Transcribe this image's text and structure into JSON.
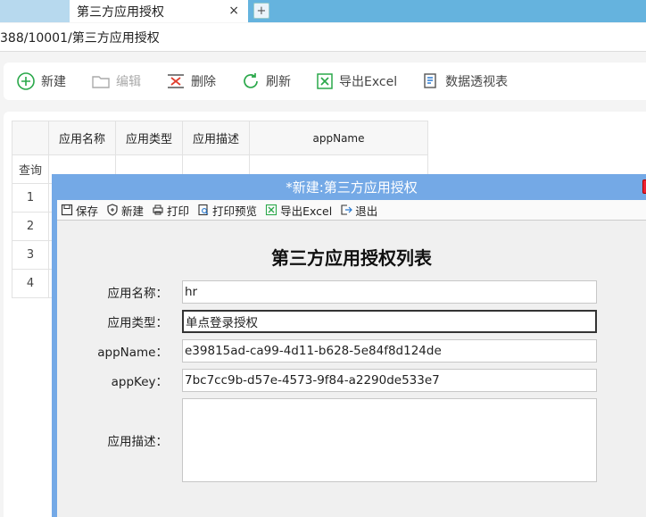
{
  "tabs": {
    "active_label": "第三方应用授权",
    "close_glyph": "×",
    "add_glyph": "+"
  },
  "breadcrumb": {
    "path": "388/10001/第三方应用授权"
  },
  "toolbar": {
    "new": "新建",
    "edit": "编辑",
    "delete": "删除",
    "refresh": "刷新",
    "export": "导出Excel",
    "pivot": "数据透视表"
  },
  "grid": {
    "columns": [
      "应用名称",
      "应用类型",
      "应用描述",
      "appName"
    ],
    "query_label": "查询",
    "row_numbers": [
      "1",
      "2",
      "3",
      "4"
    ]
  },
  "modal": {
    "title": "*新建:第三方应用授权",
    "toolbar": {
      "save": "保存",
      "new": "新建",
      "print": "打印",
      "print_preview": "打印预览",
      "export": "导出Excel",
      "exit": "退出"
    },
    "form_title": "第三方应用授权列表",
    "fields": {
      "app_name_label": "应用名称：",
      "app_name_value": "hr",
      "app_type_label": "应用类型：",
      "app_type_value": "单点登录授权",
      "appname_label": "appName：",
      "appname_value": "e39815ad-ca99-4d11-b628-5e84f8d124de",
      "appkey_label": "appKey：",
      "appkey_value": "7bc7cc9b-d57e-4573-9f84-a2290de533e7",
      "desc_label": "应用描述：",
      "desc_value": ""
    }
  },
  "colors": {
    "tabbar": "#65b3de",
    "modal_header": "#74a9e6",
    "toolbar_icon_accent": "#2aa84a"
  }
}
